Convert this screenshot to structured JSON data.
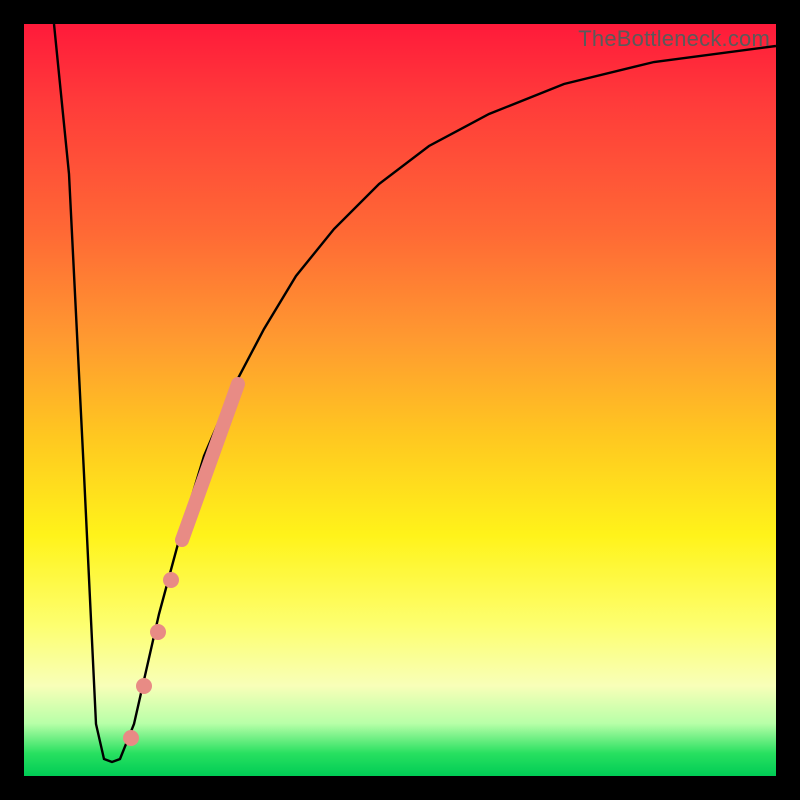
{
  "watermark": "TheBottleneck.com",
  "chart_data": {
    "type": "line",
    "title": "",
    "xlabel": "",
    "ylabel": "",
    "xlim": [
      0,
      100
    ],
    "ylim": [
      0,
      100
    ],
    "series": [
      {
        "name": "curve",
        "x": [
          4,
          6,
          8,
          10,
          11,
          12,
          13,
          15,
          18,
          21,
          24,
          28,
          32,
          36,
          41,
          47,
          54,
          62,
          72,
          84,
          100
        ],
        "y": [
          100,
          60,
          20,
          3,
          2,
          2,
          3,
          10,
          22,
          33,
          43,
          52,
          60,
          67,
          73,
          79,
          84,
          88,
          92,
          95,
          97
        ]
      }
    ],
    "markers": [
      {
        "name": "bead-1",
        "x": 14.2,
        "y": 5,
        "r": 6
      },
      {
        "name": "bead-2",
        "x": 16.0,
        "y": 12,
        "r": 6
      },
      {
        "name": "bead-3",
        "x": 17.8,
        "y": 19,
        "r": 6
      },
      {
        "name": "bead-4",
        "x": 19.6,
        "y": 26,
        "r": 6
      },
      {
        "name": "bar-start",
        "x": 21.0,
        "y": 31,
        "r": 0
      },
      {
        "name": "bar-end",
        "x": 28.5,
        "y": 52,
        "r": 0
      }
    ],
    "marker_color": "#e88b85",
    "curve_color": "#000000"
  }
}
